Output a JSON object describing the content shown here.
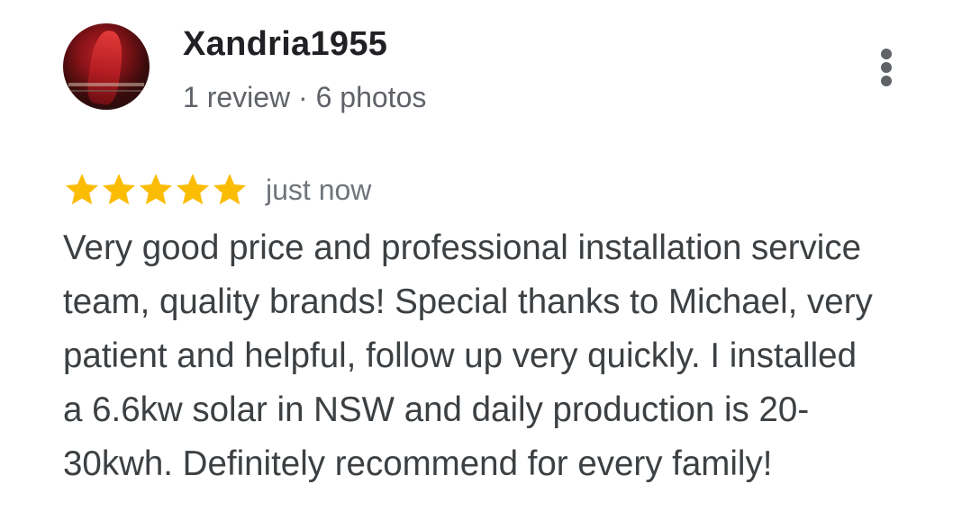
{
  "review": {
    "author": {
      "name": "Xandria1955",
      "meta": "1 review · 6 photos",
      "avatar_icon": "profile-photo"
    },
    "more_icon": "more-vert-icon",
    "rating": {
      "stars": 5,
      "max_stars": 5,
      "star_icon": "star-icon",
      "star_color": "#fbbc04"
    },
    "timestamp": "just now",
    "text": "Very good price and professional installation service team, quality brands! Special thanks to Michael, very patient and helpful, follow up very quickly. I installed a 6.6kw solar in NSW and daily production is 20-30kwh. Definitely recommend for every family!"
  }
}
